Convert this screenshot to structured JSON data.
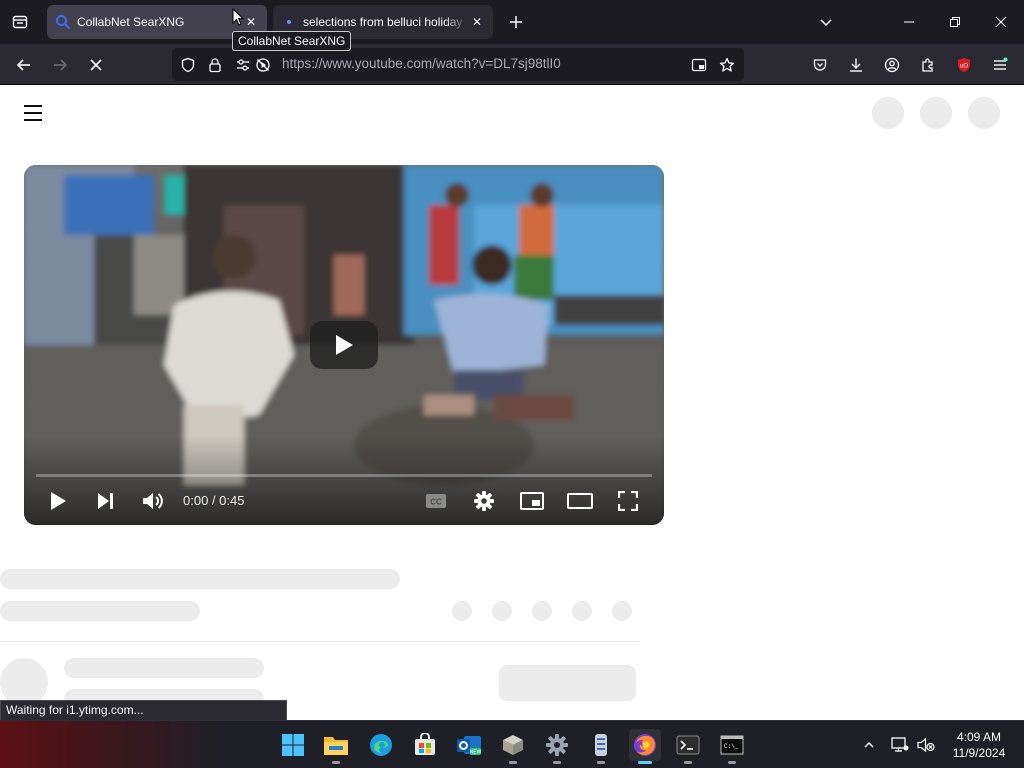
{
  "browser": {
    "tabs": [
      {
        "title": "CollabNet SearXNG",
        "active": true
      },
      {
        "title": "selections from belluci holiday",
        "active": false
      }
    ],
    "tooltip": "CollabNet SearXNG",
    "url": "https://www.youtube.com/watch?v=DL7sj98tlI0",
    "status_text": "Waiting for i1.ytimg.com..."
  },
  "player": {
    "current_time": "0:00",
    "duration": "0:45",
    "time_display": "0:00 / 0:45",
    "progress": 0
  },
  "taskbar": {
    "time": "4:09 AM",
    "date": "11/9/2024",
    "apps": [
      "windows-start",
      "file-explorer",
      "edge",
      "microsoft-store",
      "outlook-new",
      "virtualbox",
      "settings",
      "server-app",
      "firefox",
      "terminal",
      "command-prompt"
    ]
  },
  "colors": {
    "tab_strip": "#1c1b22",
    "toolbar": "#2b2a33",
    "active_tab": "#42414d",
    "taskbar": "#1f1f27",
    "accent": "#60cdff",
    "ublock": "#d61f1f"
  }
}
